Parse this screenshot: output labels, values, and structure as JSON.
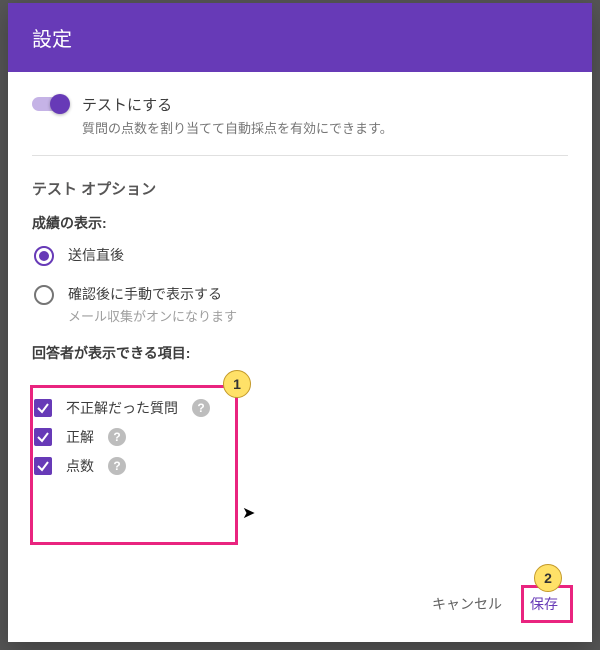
{
  "header": {
    "title": "設定"
  },
  "quiz_toggle": {
    "label": "テストにする",
    "description": "質問の点数を割り当てて自動採点を有効にできます。",
    "enabled": true
  },
  "options_section": {
    "title": "テスト オプション"
  },
  "release_grade": {
    "heading": "成績の表示:",
    "options": [
      {
        "label": "送信直後",
        "sub": "",
        "selected": true
      },
      {
        "label": "確認後に手動で表示する",
        "sub": "メール収集がオンになります",
        "selected": false
      }
    ]
  },
  "respondent_view": {
    "heading": "回答者が表示できる項目:",
    "items": [
      {
        "label": "不正解だった質問",
        "checked": true
      },
      {
        "label": "正解",
        "checked": true
      },
      {
        "label": "点数",
        "checked": true
      }
    ]
  },
  "footer": {
    "cancel": "キャンセル",
    "save": "保存"
  },
  "annotations": {
    "one": "1",
    "two": "2"
  }
}
